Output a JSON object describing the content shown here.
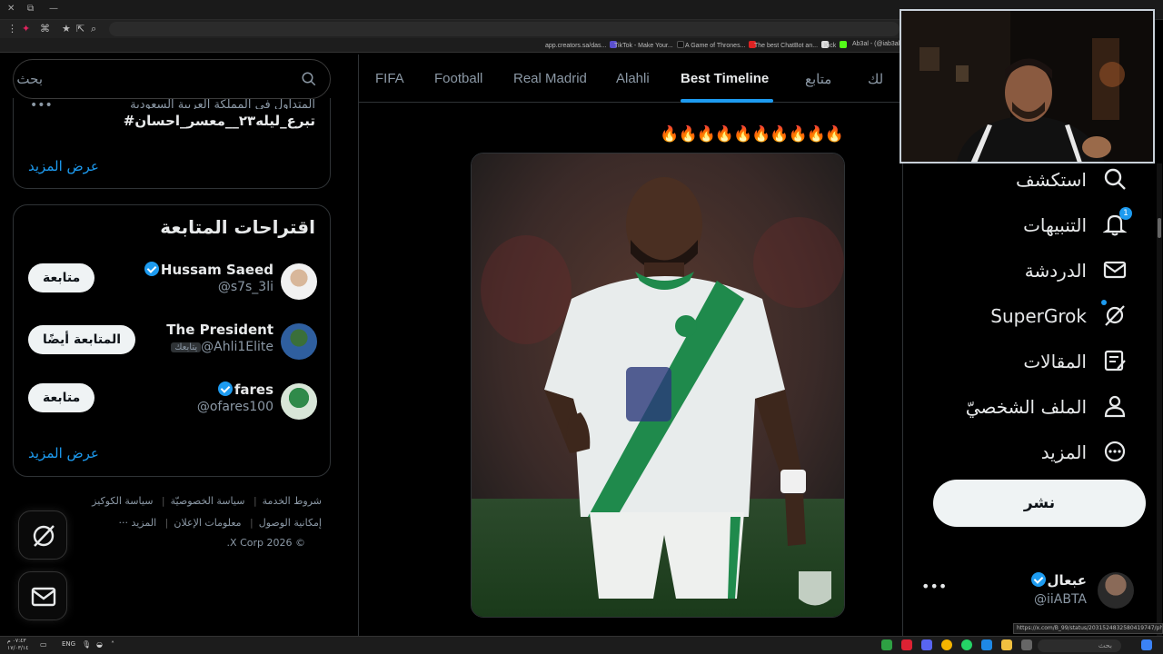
{
  "browser": {
    "bookmarks": [
      "app.creators.sa/das...",
      "TikTok - Make Your...",
      "A Game of Thrones...",
      "The best ChatBot an...",
      "Kick",
      "Ab3al - (@iab3al) |"
    ],
    "status_url": "https://x.com/B_99/status/2031524832580419747/photo/1"
  },
  "search": {
    "placeholder": "بحث"
  },
  "trends": {
    "context": "المتداول في المملكة العربية السعودية",
    "title": "#تبرع_ليله٢٣__معسر_احسان",
    "show_more": "عرض المزيد"
  },
  "who_to_follow": {
    "title": "اقتراحات المتابعة",
    "users": [
      {
        "name": "Hussam Saeed",
        "handle": "@s7s_3li",
        "verified": true,
        "button": "متابعة"
      },
      {
        "name": "The President",
        "handle": "@Ahli1Elite",
        "follows_you": "يتابعك",
        "button": "المتابعة أيضًا"
      },
      {
        "name": "fares",
        "handle": "@ofares100",
        "verified": true,
        "button": "متابعة"
      }
    ],
    "show_more": "عرض المزيد"
  },
  "footer": {
    "row1": [
      "شروط الخدمة",
      "سياسة الخصوصيّة",
      "سياسة الكوكيز"
    ],
    "row2": [
      "إمكانية الوصول",
      "معلومات الإعلان",
      "المزيد ···"
    ],
    "copyright": "© 2026 X Corp."
  },
  "tabs": [
    "FIFA",
    "Football",
    "Real Madrid",
    "Alahli",
    "Best Timeline",
    "متابع",
    "لك"
  ],
  "active_tab": "Best Timeline",
  "post": {
    "emoji_text": "🔥🔥🔥🔥🔥🔥🔥🔥🔥🔥"
  },
  "nav": {
    "explore": "استكشف",
    "notifications": "التنبيهات",
    "notifications_count": "1",
    "messages": "الدردشة",
    "grok": "SuperGrok",
    "articles": "المقالات",
    "profile": "الملف الشخصيّ",
    "more": "المزيد",
    "post_button": "نشر"
  },
  "account": {
    "name": "عبعال",
    "handle": "@iiABTA",
    "verified": true
  },
  "taskbar": {
    "time": "٠٧:٤٣ م",
    "date": "١٧/٠٣/١٤",
    "lang": "ENG",
    "search": "بحث"
  },
  "colors": {
    "accent": "#1d9bf0",
    "background": "#000000",
    "jersey_green": "#1f8a4c"
  }
}
